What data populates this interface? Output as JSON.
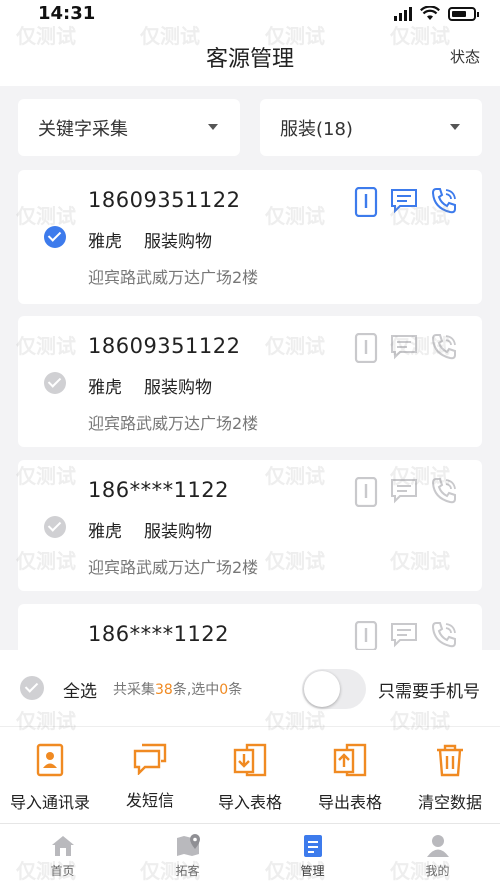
{
  "status_bar": {
    "time": "14:31"
  },
  "nav": {
    "title": "客源管理",
    "right_label": "状态"
  },
  "filters": [
    {
      "label": "关键字采集"
    },
    {
      "label": "服装(18)"
    }
  ],
  "records": [
    {
      "phone": "18609351122",
      "source": "雅虎",
      "category": "服装购物",
      "address": "迎宾路武威万达广场2楼",
      "selected": true
    },
    {
      "phone": "18609351122",
      "source": "雅虎",
      "category": "服装购物",
      "address": "迎宾路武威万达广场2楼",
      "selected": false
    },
    {
      "phone": "186****1122",
      "source": "雅虎",
      "category": "服装购物",
      "address": "迎宾路武威万达广场2楼",
      "selected": false
    },
    {
      "phone": "186****1122",
      "source": "",
      "category": "",
      "address": "",
      "selected": false
    }
  ],
  "selection": {
    "select_all": "全选",
    "stats_prefix": "共采集",
    "total": "38",
    "stats_mid": "条,选中",
    "selected": "0",
    "stats_suffix": "条",
    "toggle_label": "只需要手机号",
    "toggle_on": false
  },
  "tools": [
    {
      "label": "导入通讯录",
      "icon": "contacts-import-icon"
    },
    {
      "label": "发短信",
      "icon": "sms-icon"
    },
    {
      "label": "导入表格",
      "icon": "table-import-icon"
    },
    {
      "label": "导出表格",
      "icon": "table-export-icon"
    },
    {
      "label": "清空数据",
      "icon": "trash-icon"
    }
  ],
  "tabs": [
    {
      "label": "首页",
      "icon": "home-icon"
    },
    {
      "label": "拓客",
      "icon": "map-pin-icon"
    },
    {
      "label": "管理",
      "icon": "manage-doc-icon",
      "active": true
    },
    {
      "label": "我的",
      "icon": "profile-icon"
    }
  ],
  "watermark": "仅测试",
  "colors": {
    "accent_blue": "#3d7bec",
    "accent_orange": "#f08a22",
    "icon_gray": "#c9c9cc"
  }
}
